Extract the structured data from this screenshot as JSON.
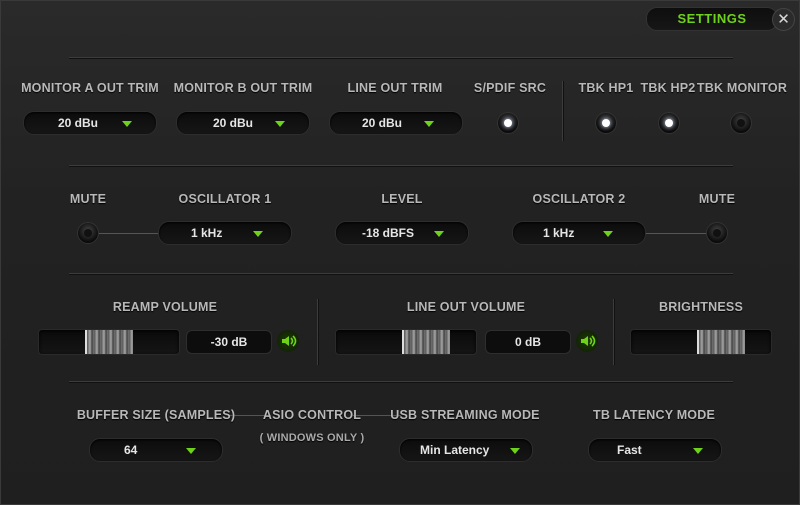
{
  "header": {
    "settings_label": "SETTINGS",
    "close_label": "✕"
  },
  "row1": {
    "monitor_a": {
      "label": "MONITOR A OUT TRIM",
      "value": "20 dBu"
    },
    "monitor_b": {
      "label": "MONITOR B OUT TRIM",
      "value": "20 dBu"
    },
    "line_out": {
      "label": "LINE OUT TRIM",
      "value": "20 dBu"
    },
    "spdif": {
      "label": "S/PDIF SRC",
      "selected": true
    },
    "tbk_hp1": {
      "label": "TBK HP1",
      "selected": true
    },
    "tbk_hp2": {
      "label": "TBK HP2",
      "selected": true
    },
    "tbk_monitor": {
      "label": "TBK MONITOR",
      "selected": false
    }
  },
  "row2": {
    "mute_left": {
      "label": "MUTE",
      "selected": false
    },
    "osc1": {
      "label": "OSCILLATOR 1",
      "value": "1 kHz"
    },
    "level": {
      "label": "LEVEL",
      "value": "-18 dBFS"
    },
    "osc2": {
      "label": "OSCILLATOR 2",
      "value": "1 kHz"
    },
    "mute_right": {
      "label": "MUTE",
      "selected": false
    }
  },
  "row3": {
    "reamp": {
      "label": "REAMP VOLUME",
      "value": "-30 dB",
      "level": 0.5
    },
    "line_out_volume": {
      "label": "LINE OUT VOLUME",
      "value": "0 dB",
      "level": 0.72
    },
    "brightness": {
      "label": "BRIGHTNESS",
      "level": 0.72
    }
  },
  "row4": {
    "buffer": {
      "label": "BUFFER SIZE (SAMPLES)",
      "value": "64"
    },
    "asio": {
      "label": "ASIO CONTROL",
      "sub": "( WINDOWS ONLY )"
    },
    "usb": {
      "label": "USB STREAMING MODE",
      "value": "Min Latency"
    },
    "tb": {
      "label": "TB LATENCY MODE",
      "value": "Fast"
    }
  },
  "colors": {
    "accent": "#6fd21a",
    "background": "#222222",
    "text": "#b8b8b8"
  },
  "icons": {
    "speaker": "speaker-icon",
    "dropdown": "chevron-down-icon",
    "close": "close-icon"
  }
}
